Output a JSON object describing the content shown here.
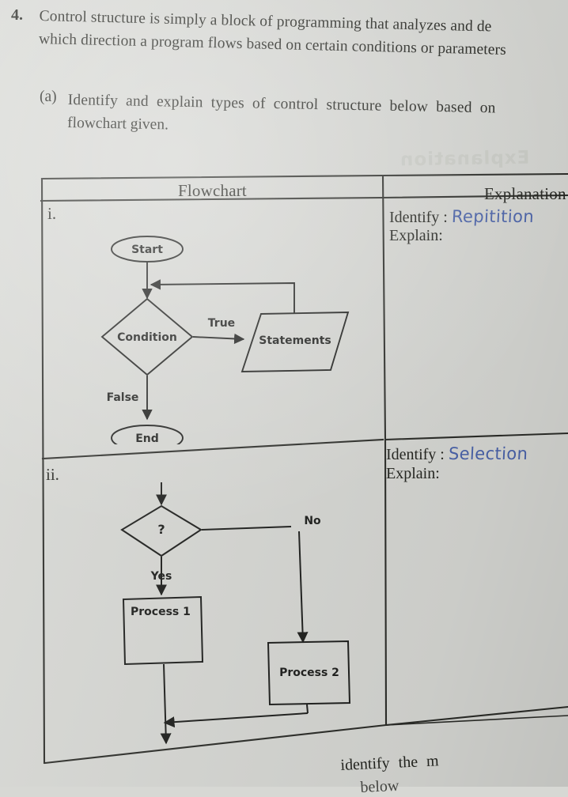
{
  "question": {
    "number": "4.",
    "line1": "Control structure is simply a block of programming that analyzes and de",
    "line2": "which direction a program flows based on certain conditions or parameters",
    "part_label": "(a)",
    "part_line1": "Identify and explain types of control structure below based on",
    "part_line2": "flowchart given."
  },
  "table": {
    "headers": {
      "flowchart": "Flowchart",
      "explanation": "Explanation"
    },
    "rows": [
      {
        "number": "i.",
        "identify_label": "Identify :",
        "identify_answer": "Repitition",
        "explain_label": "Explain:",
        "explain_answer": ""
      },
      {
        "number": "ii.",
        "identify_label": "Identify :",
        "identify_answer": "Selection",
        "explain_label": "Explain:",
        "explain_answer": ""
      }
    ]
  },
  "flowchart_i": {
    "nodes": [
      {
        "id": "start",
        "shape": "ellipse",
        "label": "Start"
      },
      {
        "id": "condition",
        "shape": "diamond",
        "label": "Condition"
      },
      {
        "id": "statements",
        "shape": "parallelogram",
        "label": "Statements"
      },
      {
        "id": "end",
        "shape": "ellipse",
        "label": "End"
      }
    ],
    "edges": [
      {
        "from": "start",
        "to": "condition",
        "label": ""
      },
      {
        "from": "condition",
        "to": "statements",
        "label": "True"
      },
      {
        "from": "statements",
        "to": "condition",
        "label": ""
      },
      {
        "from": "condition",
        "to": "end",
        "label": "False"
      }
    ]
  },
  "flowchart_ii": {
    "nodes": [
      {
        "id": "decision",
        "shape": "diamond",
        "label": "?"
      },
      {
        "id": "process1",
        "shape": "rect",
        "label": "Process 1"
      },
      {
        "id": "process2",
        "shape": "rect",
        "label": "Process 2"
      }
    ],
    "edges": [
      {
        "from": "decision",
        "to": "process1",
        "label": "Yes"
      },
      {
        "from": "decision",
        "to": "process2",
        "label": "No"
      },
      {
        "from": "process1",
        "to": "merge",
        "label": ""
      },
      {
        "from": "process2",
        "to": "merge",
        "label": ""
      }
    ]
  },
  "bottom": {
    "next_line": "identify  the  m",
    "next_line_partial": "below"
  },
  "colors": {
    "paper": "#d7d8d4",
    "ink": "#23241f",
    "handwriting": "#4a63ab"
  }
}
